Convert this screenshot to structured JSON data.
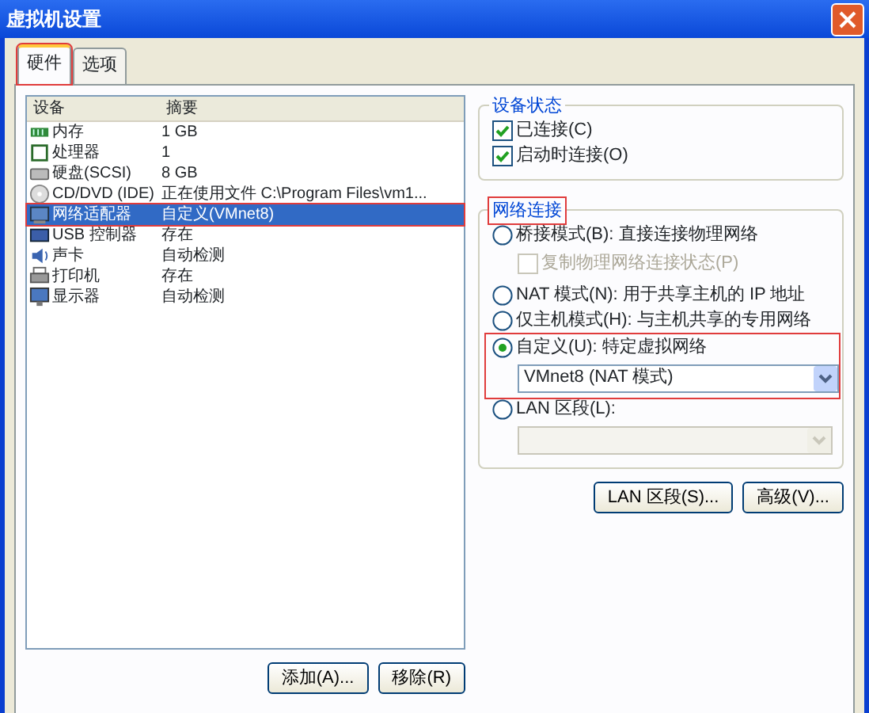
{
  "window": {
    "title": "虚拟机设置"
  },
  "tabs": [
    {
      "label": "硬件",
      "selected": true,
      "annotated": true
    },
    {
      "label": "选项",
      "selected": false,
      "annotated": false
    }
  ],
  "device_list": {
    "columns": [
      "设备",
      "摘要"
    ],
    "rows": [
      {
        "kind": "memory",
        "device": "内存",
        "summary": "1 GB",
        "selected": false,
        "annotated": false
      },
      {
        "kind": "cpu",
        "device": "处理器",
        "summary": "1",
        "selected": false,
        "annotated": false
      },
      {
        "kind": "disk",
        "device": "硬盘(SCSI)",
        "summary": "8 GB",
        "selected": false,
        "annotated": false
      },
      {
        "kind": "cdrom",
        "device": "CD/DVD (IDE)",
        "summary": "正在使用文件 C:\\Program Files\\vm1...",
        "selected": false,
        "annotated": false
      },
      {
        "kind": "network",
        "device": "网络适配器",
        "summary": "自定义(VMnet8)",
        "selected": true,
        "annotated": true
      },
      {
        "kind": "usb",
        "device": "USB 控制器",
        "summary": "存在",
        "selected": false,
        "annotated": false
      },
      {
        "kind": "sound",
        "device": "声卡",
        "summary": "自动检测",
        "selected": false,
        "annotated": false
      },
      {
        "kind": "printer",
        "device": "打印机",
        "summary": "存在",
        "selected": false,
        "annotated": false
      },
      {
        "kind": "display",
        "device": "显示器",
        "summary": "自动检测",
        "selected": false,
        "annotated": false
      }
    ],
    "buttons": [
      "添加(A)...",
      "移除(R)"
    ]
  },
  "device_status": {
    "title": "设备状态",
    "options": [
      {
        "label": "已连接(C)",
        "checked": true
      },
      {
        "label": "启动时连接(O)",
        "checked": true
      }
    ]
  },
  "network_connection": {
    "title": "网络连接",
    "annotated": true,
    "options": [
      {
        "label": "桥接模式(B): 直接连接物理网络",
        "selected": false,
        "annotated": false,
        "sub": {
          "kind": "checkbox",
          "label": "复制物理网络连接状态(P)",
          "checked": false,
          "disabled": true
        }
      },
      {
        "label": "NAT 模式(N): 用于共享主机的 IP 地址",
        "selected": false,
        "annotated": false
      },
      {
        "label": "仅主机模式(H): 与主机共享的专用网络",
        "selected": false,
        "annotated": false
      },
      {
        "label": "自定义(U): 特定虚拟网络",
        "selected": true,
        "annotated": true,
        "sub": {
          "kind": "select",
          "value": "VMnet8 (NAT 模式)",
          "disabled": false
        }
      },
      {
        "label": "LAN 区段(L):",
        "selected": false,
        "annotated": false,
        "sub": {
          "kind": "select",
          "disabled": true
        }
      }
    ]
  },
  "buttons": [
    "LAN 区段(S)...",
    "高级(V)..."
  ]
}
